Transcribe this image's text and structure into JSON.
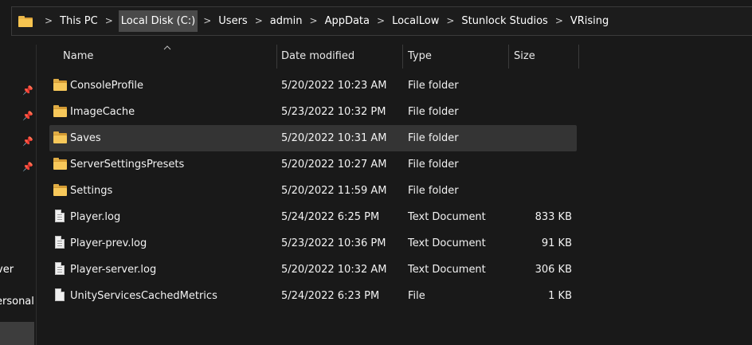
{
  "breadcrumb": {
    "items": [
      "This PC",
      "Local Disk (C:)",
      "Users",
      "admin",
      "AppData",
      "LocalLow",
      "Stunlock Studios",
      "VRising"
    ],
    "active_index": 1,
    "separator": ">"
  },
  "navpane": {
    "partial_items": [
      "ver",
      "ersonal"
    ],
    "pin_glyph": "📌"
  },
  "columns": {
    "name": "Name",
    "date": "Date modified",
    "type": "Type",
    "size": "Size"
  },
  "files": [
    {
      "name": "ConsoleProfile",
      "date": "5/20/2022 10:23 AM",
      "type": "File folder",
      "size": "",
      "icon": "folder-icon"
    },
    {
      "name": "ImageCache",
      "date": "5/23/2022 10:32 PM",
      "type": "File folder",
      "size": "",
      "icon": "folder-icon"
    },
    {
      "name": "Saves",
      "date": "5/20/2022 10:31 AM",
      "type": "File folder",
      "size": "",
      "icon": "folder-icon",
      "selected": true
    },
    {
      "name": "ServerSettingsPresets",
      "date": "5/20/2022 10:27 AM",
      "type": "File folder",
      "size": "",
      "icon": "folder-icon"
    },
    {
      "name": "Settings",
      "date": "5/20/2022 11:59 AM",
      "type": "File folder",
      "size": "",
      "icon": "folder-icon"
    },
    {
      "name": "Player.log",
      "date": "5/24/2022 6:25 PM",
      "type": "Text Document",
      "size": "833 KB",
      "icon": "text-document-icon"
    },
    {
      "name": "Player-prev.log",
      "date": "5/23/2022 10:36 PM",
      "type": "Text Document",
      "size": "91 KB",
      "icon": "text-document-icon"
    },
    {
      "name": "Player-server.log",
      "date": "5/20/2022 10:32 AM",
      "type": "Text Document",
      "size": "306 KB",
      "icon": "text-document-icon"
    },
    {
      "name": "UnityServicesCachedMetrics",
      "date": "5/24/2022 6:23 PM",
      "type": "File",
      "size": "1 KB",
      "icon": "file-icon"
    }
  ],
  "colors": {
    "background": "#191919",
    "folder": "#f7c85a",
    "selected_row": "#343434",
    "active_crumb": "#4a4a4a"
  }
}
